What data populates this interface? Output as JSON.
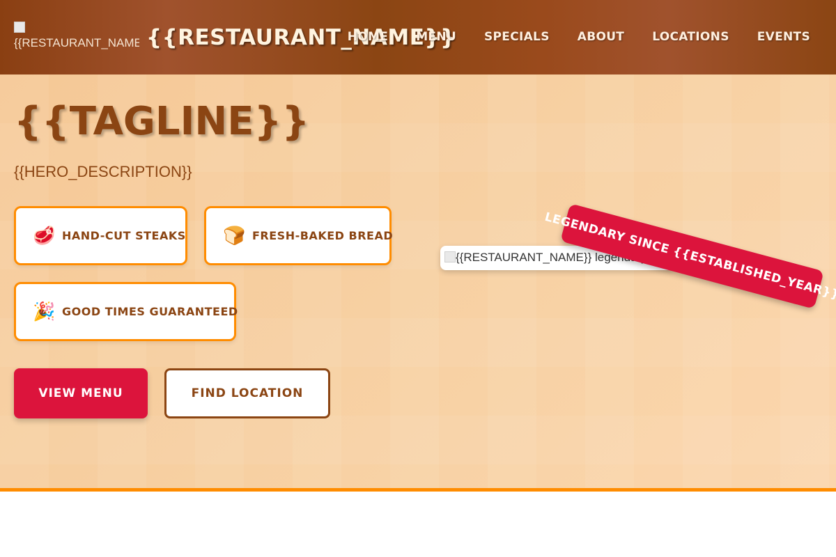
{
  "header": {
    "logo_alt": "{{RESTAURANT_NAME}}",
    "brand": "{{RESTAURANT_NAME}}",
    "nav": [
      "HOME",
      "MENU",
      "SPECIALS",
      "ABOUT",
      "LOCATIONS",
      "EVENTS"
    ]
  },
  "hero": {
    "tagline": "{{TAGLINE}}",
    "description": "{{HERO_DESCRIPTION}}",
    "features": [
      {
        "icon": "steak-icon",
        "glyph": "🥩",
        "label": "HAND-CUT STEAKS"
      },
      {
        "icon": "bread-icon",
        "glyph": "🍞",
        "label": "FRESH-BAKED BREAD"
      },
      {
        "icon": "party-popper-icon",
        "glyph": "🎉",
        "label": "GOOD TIMES GUARANTEED"
      }
    ],
    "primary_button": "VIEW MENU",
    "secondary_button": "FIND LOCATION",
    "image_alt": "{{RESTAURANT_NAME}} legendary st",
    "badge": "LEGENDARY SINCE {{ESTABLISHED_YEAR}}"
  },
  "colors": {
    "header_brown": "#8b4513",
    "accent_orange": "#ff8c00",
    "crimson": "#dc143c",
    "hero_background": "#f7d0a2"
  }
}
